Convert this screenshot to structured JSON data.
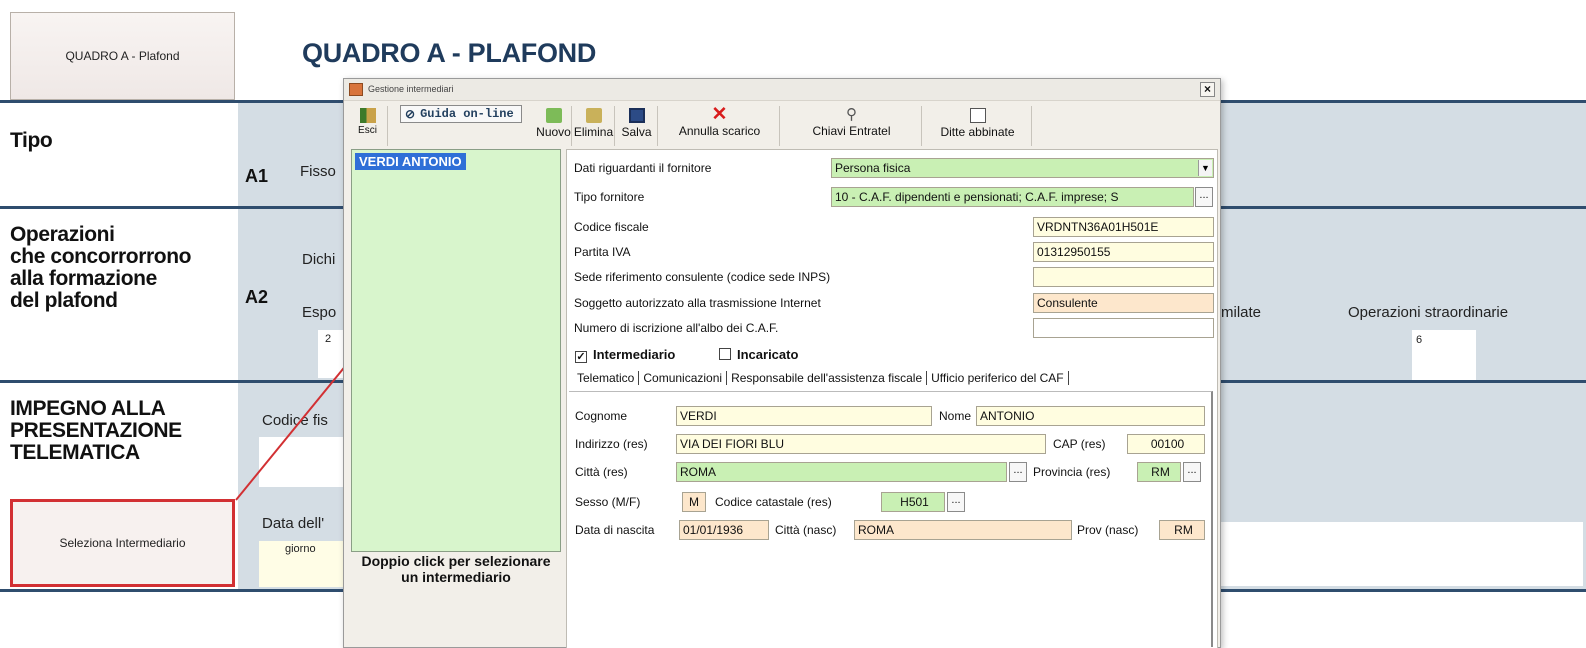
{
  "background": {
    "quadro_button_label": "QUADRO A - Plafond",
    "page_title": "QUADRO A - PLAFOND",
    "sections": {
      "tipo": "Tipo",
      "operazioni_lines": [
        "Operazioni",
        "che concorrorrono",
        "alla formazione",
        "del plafond"
      ],
      "impegno_lines": [
        "IMPEGNO ALLA",
        "PRESENTAZIONE",
        "TELEMATICA"
      ]
    },
    "codes": {
      "a1": "A1",
      "a2": "A2"
    },
    "labels": {
      "fisso": "Fisso",
      "dichi": "Dichi",
      "espo": "Espo",
      "espo_value": "2",
      "milate": "milate",
      "operazioni_straordinarie": "Operazioni straordinarie",
      "straord_value": "6",
      "codice_fis": "Codice fis",
      "data_dell": "Data dell'",
      "giorno": "giorno"
    },
    "select_button_label": "Seleziona Intermediario"
  },
  "dialog": {
    "title": "Gestione intermediari",
    "close_glyph": "×",
    "toolbar": {
      "esci": "Esci",
      "guida": "Guida on-line",
      "nuovo": "Nuovo",
      "elimina": "Elimina",
      "salva": "Salva",
      "annulla": "Annulla scarico",
      "chiavi": "Chiavi Entratel",
      "ditte": "Ditte abbinate"
    },
    "list": {
      "selected_item": "VERDI ANTONIO",
      "hint": "Doppio click per selezionare un intermediario"
    },
    "form": {
      "dati_fornitore_label": "Dati riguardanti il fornitore",
      "dati_fornitore_value": "Persona fisica",
      "tipo_fornitore_label": "Tipo fornitore",
      "tipo_fornitore_value": "10 - C.A.F. dipendenti e pensionati; C.A.F. imprese; S",
      "codice_fiscale_label": "Codice fiscale",
      "codice_fiscale_value": "VRDNTN36A01H501E",
      "partita_iva_label": "Partita IVA",
      "partita_iva_value": "01312950155",
      "sede_label": "Sede riferimento consulente (codice sede INPS)",
      "sede_value": "",
      "soggetto_label": "Soggetto autorizzato alla trasmissione Internet",
      "soggetto_value": "Consulente",
      "numero_label": "Numero di iscrizione all'albo dei C.A.F.",
      "numero_value": "",
      "intermediario_label": "Intermediario",
      "intermediario_checked": true,
      "incaricato_label": "Incaricato",
      "incaricato_checked": false
    },
    "tabs": [
      "Telematico",
      "Comunicazioni",
      "Responsabile dell'assistenza fiscale",
      "Ufficio periferico del CAF"
    ],
    "telematico": {
      "cognome_label": "Cognome",
      "cognome_value": "VERDI",
      "nome_label": "Nome",
      "nome_value": "ANTONIO",
      "indirizzo_label": "Indirizzo (res)",
      "indirizzo_value": "VIA DEI FIORI BLU",
      "cap_label": "CAP (res)",
      "cap_value": "00100",
      "citta_label": "Città (res)",
      "citta_value": "ROMA",
      "provincia_label": "Provincia (res)",
      "provincia_value": "RM",
      "sesso_label": "Sesso (M/F)",
      "sesso_value": "M",
      "catastale_label": "Codice catastale (res)",
      "catastale_value": "H501",
      "data_nascita_label": "Data di nascita",
      "data_nascita_value": "01/01/1936",
      "citta_nasc_label": "Città (nasc)",
      "citta_nasc_value": "ROMA",
      "prov_nasc_label": "Prov (nasc)",
      "prov_nasc_value": "RM"
    }
  },
  "colors": {
    "accent_dark_blue": "#2f4d6e",
    "annotation_red": "#d23033",
    "list_green": "#d8f5cc",
    "field_green": "#c9f0b4",
    "field_yellow": "#fffde0",
    "field_peach": "#fde7cc",
    "selection_blue": "#2f6fd7"
  }
}
